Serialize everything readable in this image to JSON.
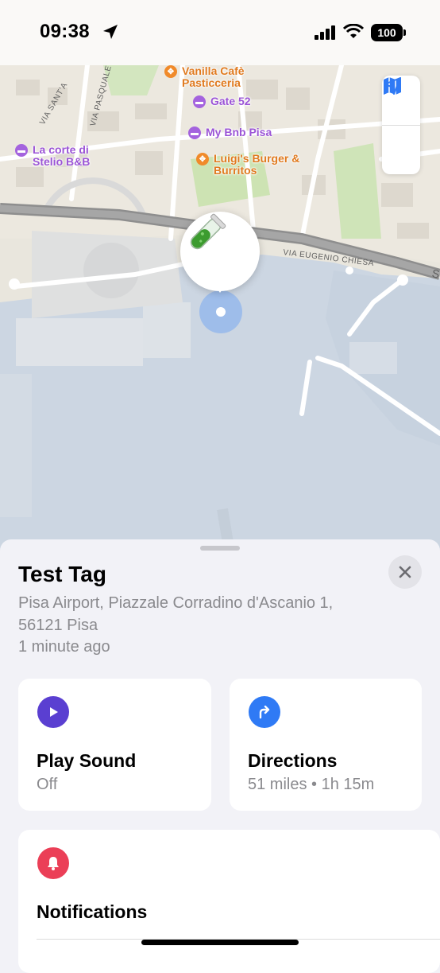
{
  "status_bar": {
    "time": "09:38",
    "battery": "100"
  },
  "map": {
    "pois": [
      {
        "name": "Vanilla Café Pasticceria",
        "line1": "Vanilla Cafè",
        "line2": "Pasticceria",
        "type": "food"
      },
      {
        "name": "Gate 52",
        "line1": "Gate 52",
        "type": "hotel"
      },
      {
        "name": "My Bnb Pisa",
        "line1": "My Bnb Pisa",
        "type": "hotel"
      },
      {
        "name": "Luigi's Burger & Burritos",
        "line1": "Luigi's Burger &",
        "line2": "Burritos",
        "type": "food"
      },
      {
        "name": "La corte di Stelio B&B",
        "line1": "La corte di",
        "line2": "Stelio B&B",
        "type": "hotel"
      }
    ],
    "streets": [
      "VIA SANT'A",
      "VIA PASQUALE",
      "VIA EUGENIO CHIESA",
      "S"
    ],
    "controls": {
      "map_icon": "map-icon",
      "location_icon": "location-arrow-icon"
    },
    "pin_icon": "test-tube-icon"
  },
  "sheet": {
    "title": "Test Tag",
    "address_line1": "Pisa Airport, Piazzale Corradino d'Ascanio 1,",
    "address_line2": "56121 Pisa",
    "time_ago": "1 minute ago",
    "play_sound": {
      "label": "Play Sound",
      "status": "Off",
      "icon": "play-icon",
      "color": "#5a3fd1"
    },
    "directions": {
      "label": "Directions",
      "detail": "51 miles • 1h 15m",
      "icon": "turn-right-arrow-icon",
      "color": "#2f7af5"
    },
    "notifications": {
      "label": "Notifications",
      "icon": "bell-icon",
      "color": "#eb3f57"
    }
  }
}
